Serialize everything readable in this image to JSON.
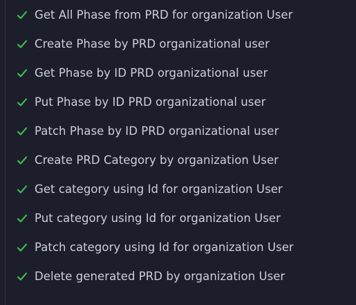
{
  "colors": {
    "background": "#1c1e2b",
    "check": "#3fb950",
    "text": "#cdd0d8"
  },
  "status_icon": "check-icon",
  "tests": [
    {
      "status": "passed",
      "name": "Get All Phase from PRD for organization User"
    },
    {
      "status": "passed",
      "name": "Create Phase by PRD organizational user"
    },
    {
      "status": "passed",
      "name": "Get Phase by ID PRD organizational user"
    },
    {
      "status": "passed",
      "name": "Put Phase by ID PRD organizational user"
    },
    {
      "status": "passed",
      "name": "Patch Phase by ID PRD organizational user"
    },
    {
      "status": "passed",
      "name": "Create PRD Category by organization User"
    },
    {
      "status": "passed",
      "name": "Get category using Id for organization User"
    },
    {
      "status": "passed",
      "name": "Put category using Id for organization User"
    },
    {
      "status": "passed",
      "name": "Patch category using Id for organization User"
    },
    {
      "status": "passed",
      "name": "Delete generated PRD by organization User"
    }
  ]
}
